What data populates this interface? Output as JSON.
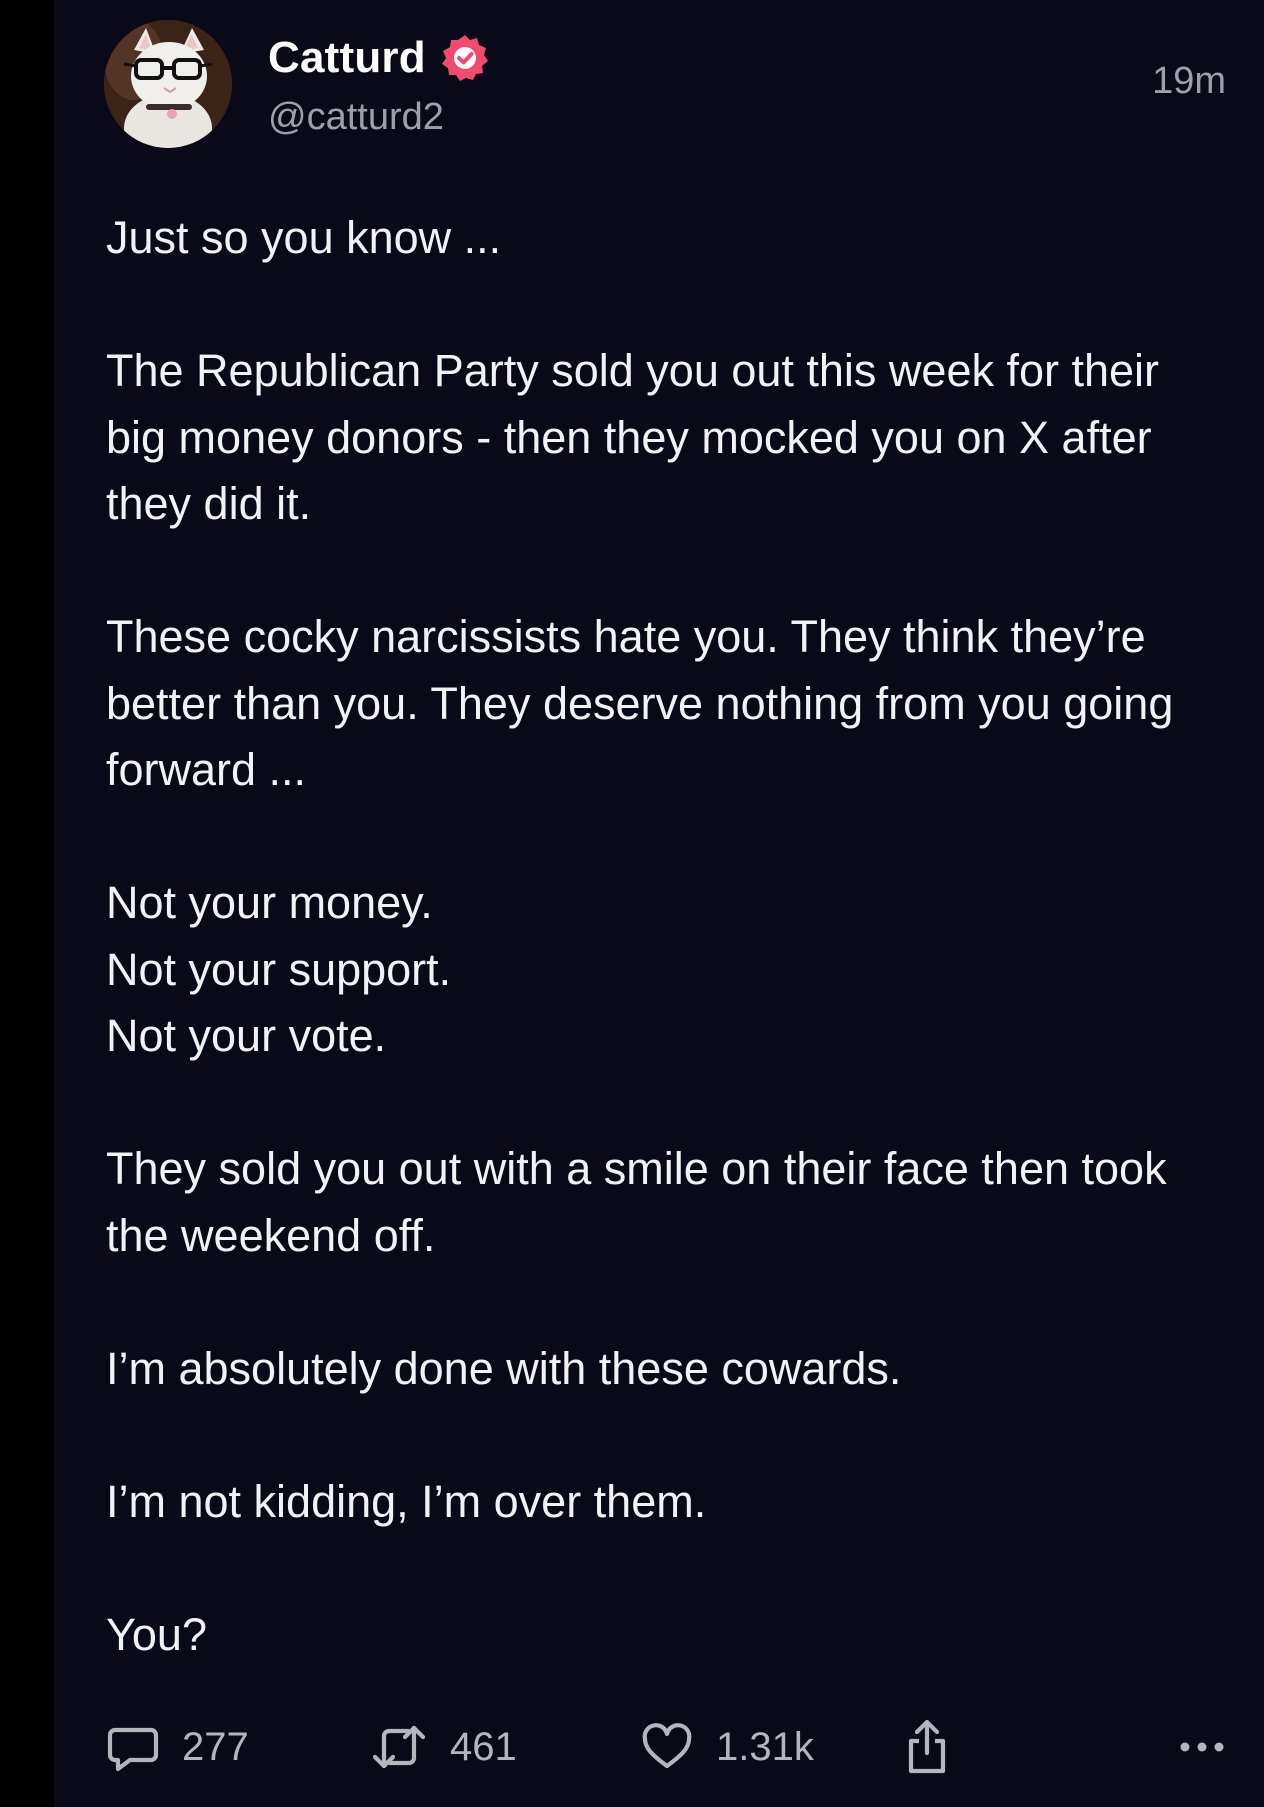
{
  "post": {
    "display_name": "Catturd",
    "handle": "@catturd2",
    "timestamp": "19m",
    "verified_icon": "verified-badge-icon",
    "verified_color": "#f04a6e",
    "body": "Just so you know ...\n\nThe Republican Party sold you out this week for their big money donors - then they mocked you on X after they did it.\n\nThese cocky narcissists hate you. They think they’re better than you. They deserve nothing from you going forward ...\n\nNot your money.\nNot your support.\nNot your vote.\n\nThey sold you out with a smile on their face then took the weekend off.\n\nI’m absolutely done with these cowards.\n\nI’m not kidding, I’m over them.\n\nYou?"
  },
  "actions": {
    "reply": {
      "icon": "reply-icon",
      "count": "277"
    },
    "repost": {
      "icon": "repost-icon",
      "count": "461"
    },
    "like": {
      "icon": "heart-icon",
      "count": "1.31k"
    },
    "share": {
      "icon": "share-icon"
    },
    "more": {
      "icon": "more-icon"
    }
  },
  "colors": {
    "background": "#0a0917",
    "text": "#f2f2f5",
    "muted": "#9ea0a9"
  }
}
